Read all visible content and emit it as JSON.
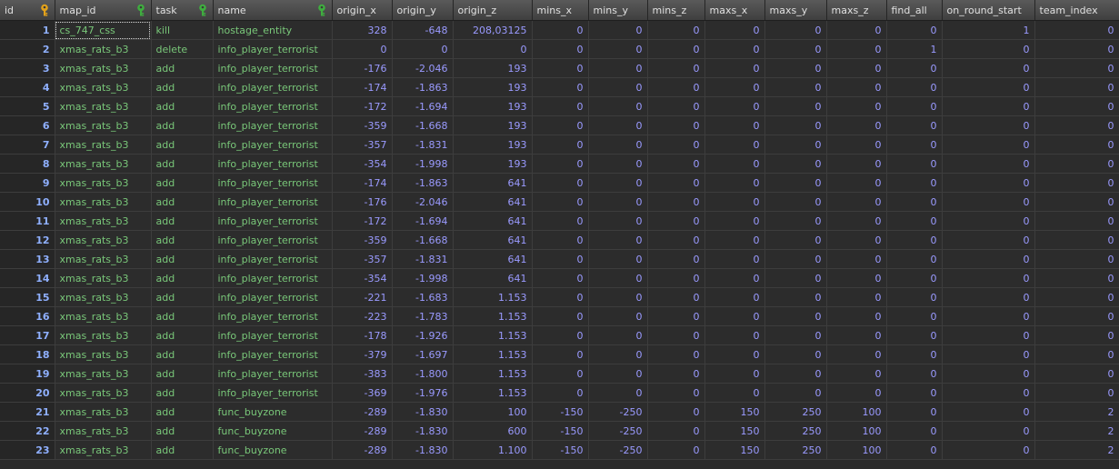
{
  "columns": [
    {
      "label": "id",
      "key": "gold"
    },
    {
      "label": "map_id",
      "key": "green"
    },
    {
      "label": "task",
      "key": "green"
    },
    {
      "label": "name",
      "key": "green"
    },
    {
      "label": "origin_x",
      "key": ""
    },
    {
      "label": "origin_y",
      "key": ""
    },
    {
      "label": "origin_z",
      "key": ""
    },
    {
      "label": "mins_x",
      "key": ""
    },
    {
      "label": "mins_y",
      "key": ""
    },
    {
      "label": "mins_z",
      "key": ""
    },
    {
      "label": "maxs_x",
      "key": ""
    },
    {
      "label": "maxs_y",
      "key": ""
    },
    {
      "label": "maxs_z",
      "key": ""
    },
    {
      "label": "find_all",
      "key": ""
    },
    {
      "label": "on_round_start",
      "key": ""
    },
    {
      "label": "team_index",
      "key": ""
    }
  ],
  "rows": [
    [
      "1",
      "cs_747_css",
      "kill",
      "hostage_entity",
      "328",
      "-648",
      "208,03125",
      "0",
      "0",
      "0",
      "0",
      "0",
      "0",
      "0",
      "1",
      "0"
    ],
    [
      "2",
      "xmas_rats_b3",
      "delete",
      "info_player_terrorist",
      "0",
      "0",
      "0",
      "0",
      "0",
      "0",
      "0",
      "0",
      "0",
      "1",
      "0",
      "0"
    ],
    [
      "3",
      "xmas_rats_b3",
      "add",
      "info_player_terrorist",
      "-176",
      "-2.046",
      "193",
      "0",
      "0",
      "0",
      "0",
      "0",
      "0",
      "0",
      "0",
      "0"
    ],
    [
      "4",
      "xmas_rats_b3",
      "add",
      "info_player_terrorist",
      "-174",
      "-1.863",
      "193",
      "0",
      "0",
      "0",
      "0",
      "0",
      "0",
      "0",
      "0",
      "0"
    ],
    [
      "5",
      "xmas_rats_b3",
      "add",
      "info_player_terrorist",
      "-172",
      "-1.694",
      "193",
      "0",
      "0",
      "0",
      "0",
      "0",
      "0",
      "0",
      "0",
      "0"
    ],
    [
      "6",
      "xmas_rats_b3",
      "add",
      "info_player_terrorist",
      "-359",
      "-1.668",
      "193",
      "0",
      "0",
      "0",
      "0",
      "0",
      "0",
      "0",
      "0",
      "0"
    ],
    [
      "7",
      "xmas_rats_b3",
      "add",
      "info_player_terrorist",
      "-357",
      "-1.831",
      "193",
      "0",
      "0",
      "0",
      "0",
      "0",
      "0",
      "0",
      "0",
      "0"
    ],
    [
      "8",
      "xmas_rats_b3",
      "add",
      "info_player_terrorist",
      "-354",
      "-1.998",
      "193",
      "0",
      "0",
      "0",
      "0",
      "0",
      "0",
      "0",
      "0",
      "0"
    ],
    [
      "9",
      "xmas_rats_b3",
      "add",
      "info_player_terrorist",
      "-174",
      "-1.863",
      "641",
      "0",
      "0",
      "0",
      "0",
      "0",
      "0",
      "0",
      "0",
      "0"
    ],
    [
      "10",
      "xmas_rats_b3",
      "add",
      "info_player_terrorist",
      "-176",
      "-2.046",
      "641",
      "0",
      "0",
      "0",
      "0",
      "0",
      "0",
      "0",
      "0",
      "0"
    ],
    [
      "11",
      "xmas_rats_b3",
      "add",
      "info_player_terrorist",
      "-172",
      "-1.694",
      "641",
      "0",
      "0",
      "0",
      "0",
      "0",
      "0",
      "0",
      "0",
      "0"
    ],
    [
      "12",
      "xmas_rats_b3",
      "add",
      "info_player_terrorist",
      "-359",
      "-1.668",
      "641",
      "0",
      "0",
      "0",
      "0",
      "0",
      "0",
      "0",
      "0",
      "0"
    ],
    [
      "13",
      "xmas_rats_b3",
      "add",
      "info_player_terrorist",
      "-357",
      "-1.831",
      "641",
      "0",
      "0",
      "0",
      "0",
      "0",
      "0",
      "0",
      "0",
      "0"
    ],
    [
      "14",
      "xmas_rats_b3",
      "add",
      "info_player_terrorist",
      "-354",
      "-1.998",
      "641",
      "0",
      "0",
      "0",
      "0",
      "0",
      "0",
      "0",
      "0",
      "0"
    ],
    [
      "15",
      "xmas_rats_b3",
      "add",
      "info_player_terrorist",
      "-221",
      "-1.683",
      "1.153",
      "0",
      "0",
      "0",
      "0",
      "0",
      "0",
      "0",
      "0",
      "0"
    ],
    [
      "16",
      "xmas_rats_b3",
      "add",
      "info_player_terrorist",
      "-223",
      "-1.783",
      "1.153",
      "0",
      "0",
      "0",
      "0",
      "0",
      "0",
      "0",
      "0",
      "0"
    ],
    [
      "17",
      "xmas_rats_b3",
      "add",
      "info_player_terrorist",
      "-178",
      "-1.926",
      "1.153",
      "0",
      "0",
      "0",
      "0",
      "0",
      "0",
      "0",
      "0",
      "0"
    ],
    [
      "18",
      "xmas_rats_b3",
      "add",
      "info_player_terrorist",
      "-379",
      "-1.697",
      "1.153",
      "0",
      "0",
      "0",
      "0",
      "0",
      "0",
      "0",
      "0",
      "0"
    ],
    [
      "19",
      "xmas_rats_b3",
      "add",
      "info_player_terrorist",
      "-383",
      "-1.800",
      "1.153",
      "0",
      "0",
      "0",
      "0",
      "0",
      "0",
      "0",
      "0",
      "0"
    ],
    [
      "20",
      "xmas_rats_b3",
      "add",
      "info_player_terrorist",
      "-369",
      "-1.976",
      "1.153",
      "0",
      "0",
      "0",
      "0",
      "0",
      "0",
      "0",
      "0",
      "0"
    ],
    [
      "21",
      "xmas_rats_b3",
      "add",
      "func_buyzone",
      "-289",
      "-1.830",
      "100",
      "-150",
      "-250",
      "0",
      "150",
      "250",
      "100",
      "0",
      "0",
      "2"
    ],
    [
      "22",
      "xmas_rats_b3",
      "add",
      "func_buyzone",
      "-289",
      "-1.830",
      "600",
      "-150",
      "-250",
      "0",
      "150",
      "250",
      "100",
      "0",
      "0",
      "2"
    ],
    [
      "23",
      "xmas_rats_b3",
      "add",
      "func_buyzone",
      "-289",
      "-1.830",
      "1.100",
      "-150",
      "-250",
      "0",
      "150",
      "250",
      "100",
      "0",
      "0",
      "2"
    ]
  ],
  "colors": {
    "primary_key": "#e3a21a",
    "index_key": "#3fae3f",
    "text_cell": "#79c779",
    "number_cell": "#9a9aff",
    "row_id": "#8fb0ff"
  },
  "selected_cell": {
    "row": 0,
    "col": 1
  }
}
